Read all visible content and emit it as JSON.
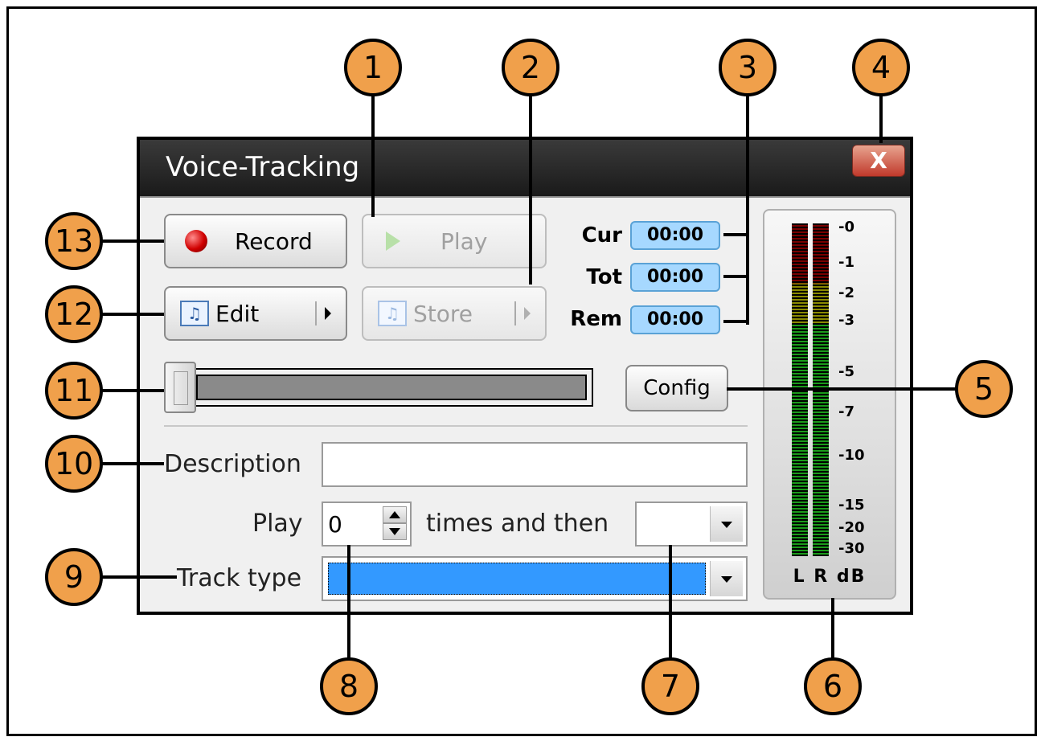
{
  "window": {
    "title": "Voice-Tracking",
    "close_glyph": "X"
  },
  "buttons": {
    "record": "Record",
    "play": "Play",
    "edit": "Edit",
    "store": "Store",
    "config": "Config"
  },
  "timers": [
    {
      "label": "Cur",
      "value": "00:00"
    },
    {
      "label": "Tot",
      "value": "00:00"
    },
    {
      "label": "Rem",
      "value": "00:00"
    }
  ],
  "meter": {
    "db_labels": [
      "-0",
      "-1",
      "-2",
      "-3",
      "-5",
      "-7",
      "-10",
      "-15",
      "-20",
      "-30"
    ],
    "footer": "L R dB"
  },
  "form": {
    "description_label": "Description",
    "description_value": "",
    "play_label": "Play",
    "play_times_value": "0",
    "times_then_label": "times and then",
    "then_value": "",
    "track_type_label": "Track type",
    "track_type_value": ""
  },
  "callouts": [
    "1",
    "2",
    "3",
    "4",
    "5",
    "6",
    "7",
    "8",
    "9",
    "10",
    "11",
    "12",
    "13"
  ]
}
